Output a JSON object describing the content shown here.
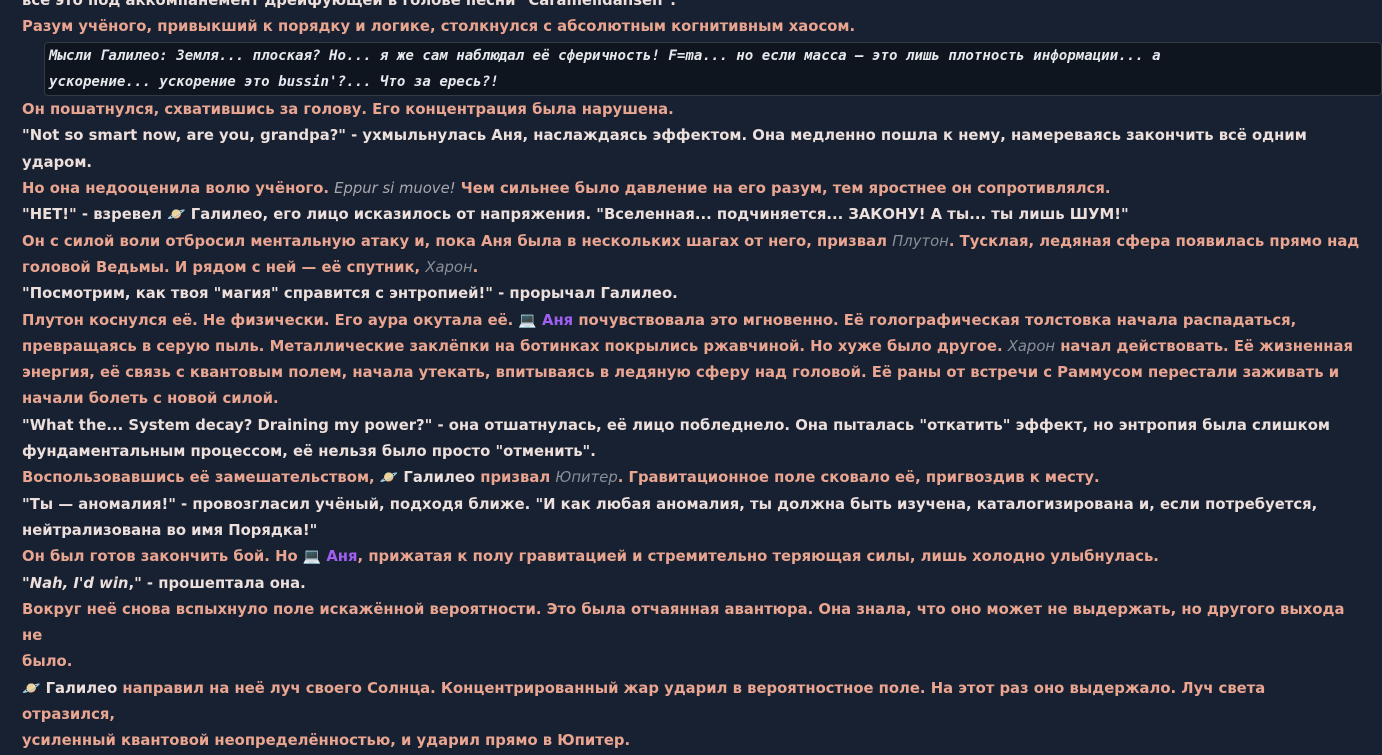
{
  "lines": {
    "l0": "все это под аккомпанемент дрейфующей в голове песни \"Caramelldansen\".",
    "l1": "Разум учёного, привыкший к порядку и логике, столкнулся с абсолютным когнитивным хаосом.",
    "l2": "Мысли Галилео: Земля... плоская? Но... я же сам наблюдал её сферичность! F=ma... но если масса — это лишь плотность информации... а",
    "l3": "ускорение... ускорение это bussin'?... Что за ересь?!",
    "l4": "Он пошатнулся, схватившись за голову. Его концентрация была нарушена.",
    "l5": "\"Not so smart now, are you, grandpa?\" - ухмыльнулась Аня, наслаждаясь эффектом. Она медленно пошла к нему, намереваясь закончить всё одним ударом.",
    "l6a": "Но она недооценила волю учёного. ",
    "l6b": "Eppur si muove!",
    "l6c": " Чем сильнее было давление на его разум, тем яростнее он сопротивлялся.",
    "l7a": "\"НЕТ!\" - взревел ",
    "l7c": ", его лицо исказилось от напряжения. \"Вселенная... подчиняется... ЗАКОНУ! А ты... ты лишь ШУМ!\"",
    "l8a": "Он с силой воли отбросил ментальную атаку и, пока Аня была в нескольких шагах от него, призвал ",
    "l8b": "Плутон",
    "l8c": ". Тусклая, ледяная сфера появилась прямо над",
    "l9a": "головой Ведьмы. И рядом с ней — её спутник, ",
    "l9b": "Харон",
    "l9c": ".",
    "l10": "\"Посмотрим, как твоя \"магия\" справится с энтропией!\" - прорычал Галилео.",
    "l11a": "Плутон коснулся её. Не физически. Его аура окутала её. ",
    "l11c": " почувствовала это мгновенно. Её голографическая толстовка начала распадаться,",
    "l12a": "превращаясь в серую пыль. Металлические заклёпки на ботинках покрылись ржавчиной. Но хуже было другое. ",
    "l12b": "Харон",
    "l12c": " начал действовать. Её жизненная",
    "l13": "энергия, её связь с квантовым полем, начала утекать, впитываясь в ледяную сферу над головой. Её раны от встречи с Раммусом перестали заживать и",
    "l14": "начали болеть с новой силой.",
    "l15": "\"What the... System decay? Draining my power?\" - она отшатнулась, её лицо побледнело. Она пыталась \"откатить\" эффект, но энтропия была слишком",
    "l16": "фундаментальным процессом, её нельзя было просто \"отменить\".",
    "l17a": "Воспользовавшись её замешательством, ",
    "l17c": " призвал ",
    "l17d": "Юпитер",
    "l17e": ". Гравитационное поле сковало её, пригвоздив к месту.",
    "l18": "\"Ты — аномалия!\" - провозгласил учёный, подходя ближе. \"И как любая аномалия, ты должна быть изучена, каталогизирована и, если потребуется,",
    "l19": "нейтрализована во имя Порядка!\"",
    "l20a": "Он был готов закончить бой. Но ",
    "l20c": ", прижатая к полу гравитацией и стремительно теряющая силы, лишь холодно улыбнулась.",
    "l21a": "\"",
    "l21b": "Nah, I'd win",
    "l21c": ",\" - прошептала она.",
    "l22": "Вокруг неё снова вспыхнуло поле искажённой вероятности. Это была отчаянная авантюра. Она знала, что оно может не выдержать, но другого выхода не",
    "l23": "было.",
    "l24c": " направил на неё луч своего Солнца. Концентрированный жар ударил в вероятностное поле. На этот раз оно выдержало. Луч света отразился,",
    "l25": "усиленный квантовой неопределённостью, и ударил прямо в Юпитер."
  },
  "mentions": {
    "galileo": "Галилео",
    "anya": "Аня"
  },
  "icons": {
    "galileo": "planet-icon",
    "anya": "laptop-icon"
  },
  "colors": {
    "background": "#172131",
    "narration": "#eaa591",
    "dialogue": "#ecdfdc",
    "anya_mention": "#a05ef2",
    "spell_name": "#8a8e98"
  }
}
